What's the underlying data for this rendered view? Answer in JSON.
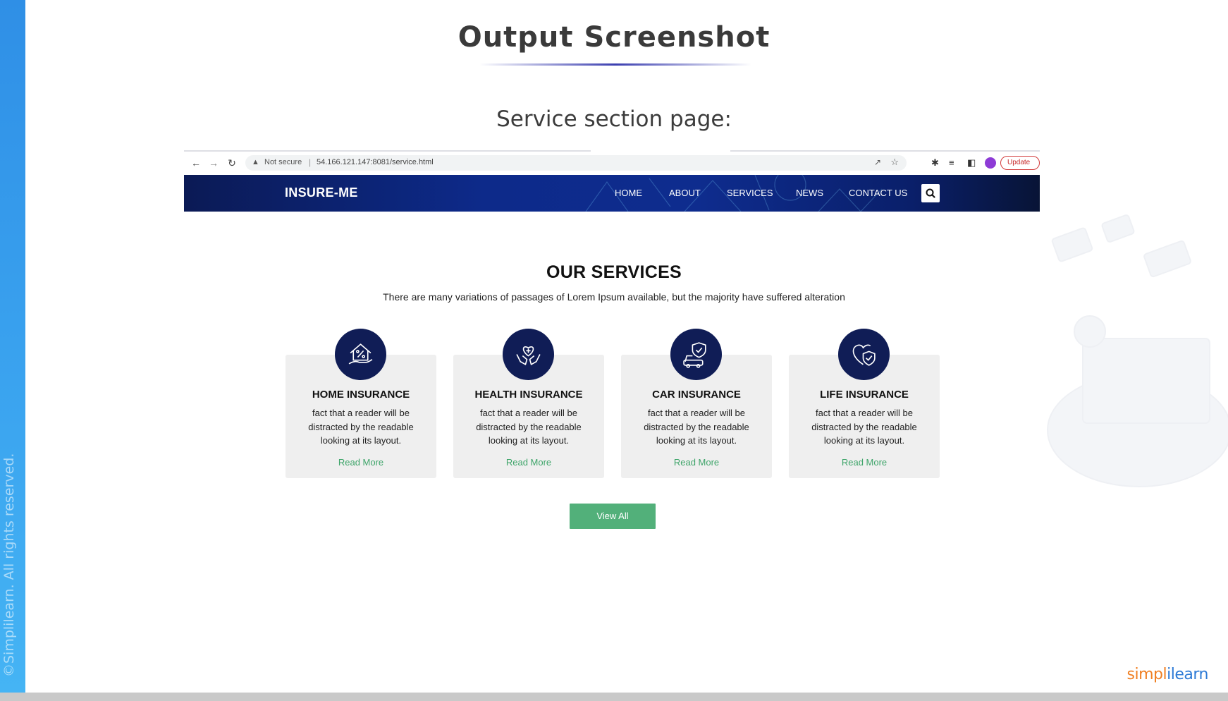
{
  "slide": {
    "title": "Output Screenshot",
    "subtitle": "Service section page:",
    "copyright": "©Simplilearn. All rights reserved.",
    "logo_orange": "simpl",
    "logo_mid": "i",
    "logo_blue": "learn"
  },
  "browser": {
    "security_label": "Not secure",
    "separator": "|",
    "url": "54.166.121.147:8081/service.html",
    "update_label": "Update"
  },
  "site": {
    "brand": "INSURE-ME",
    "nav": [
      "HOME",
      "ABOUT",
      "SERVICES",
      "NEWS",
      "CONTACT US"
    ]
  },
  "services": {
    "title": "OUR SERVICES",
    "subtitle": "There are many variations of passages of Lorem Ipsum available, but the majority have suffered alteration",
    "cards": [
      {
        "title": "HOME INSURANCE",
        "text": "fact that a reader will be distracted by the readable looking at its layout.",
        "link": "Read More",
        "icon": "house-percent-icon"
      },
      {
        "title": "HEALTH INSURANCE",
        "text": "fact that a reader will be distracted by the readable looking at its layout.",
        "link": "Read More",
        "icon": "hands-heart-icon"
      },
      {
        "title": "CAR INSURANCE",
        "text": "fact that a reader will be distracted by the readable looking at its layout.",
        "link": "Read More",
        "icon": "car-shield-icon"
      },
      {
        "title": "LIFE INSURANCE",
        "text": "fact that a reader will be distracted by the readable looking at its layout.",
        "link": "Read More",
        "icon": "heart-shield-icon"
      }
    ],
    "view_all": "View All"
  },
  "colors": {
    "header_navy": "#0d2a8a",
    "icon_circle": "#101d56",
    "accent_green": "#52b07a",
    "card_bg": "#efefef"
  }
}
